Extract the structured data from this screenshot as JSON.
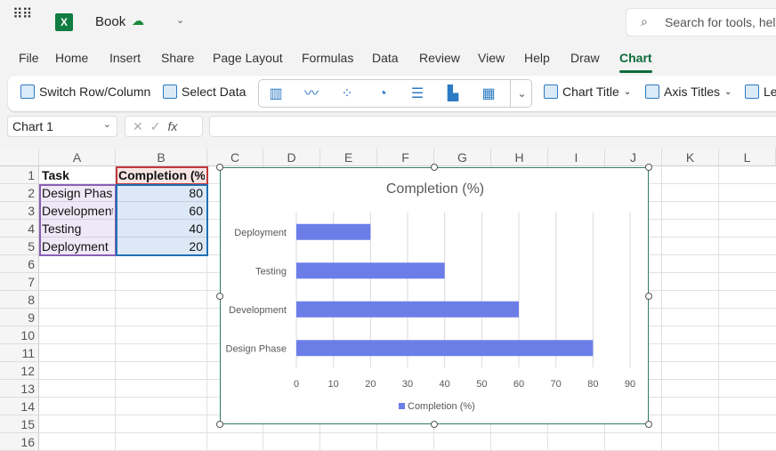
{
  "titlebar": {
    "app_icon": "excel-logo",
    "doc_name": "Book",
    "search_placeholder": "Search for tools, help"
  },
  "menu_tabs": [
    "File",
    "Home",
    "Insert",
    "Share",
    "Page Layout",
    "Formulas",
    "Data",
    "Review",
    "View",
    "Help",
    "Draw",
    "Chart"
  ],
  "active_tab": "Chart",
  "ribbon": {
    "switch": "Switch Row/Column",
    "select": "Select Data",
    "chart_title": "Chart Title",
    "axis_titles": "Axis Titles",
    "legend": "Le"
  },
  "formula_bar": {
    "name_box": "Chart 1",
    "fx": "fx",
    "formula": ""
  },
  "columns": [
    "A",
    "B",
    "C",
    "D",
    "E",
    "F",
    "G",
    "H",
    "I",
    "J",
    "K",
    "L"
  ],
  "rows": [
    "1",
    "2",
    "3",
    "4",
    "5",
    "6",
    "7",
    "8",
    "9",
    "10",
    "11",
    "12",
    "13",
    "14",
    "15",
    "16"
  ],
  "cells": {
    "A1": "Task",
    "B1": "Completion (%)",
    "A2": "Design Phase",
    "B2": "80",
    "A3": "Development",
    "B3": "60",
    "A4": "Testing",
    "B4": "40",
    "A5": "Deployment",
    "B5": "20"
  },
  "colors": {
    "bar": "#6b7ee8",
    "accent": "#0e6b3a"
  },
  "chart_data": {
    "type": "bar",
    "orientation": "horizontal",
    "title": "Completion (%)",
    "categories": [
      "Design Phase",
      "Development",
      "Testing",
      "Deployment"
    ],
    "values": [
      80,
      60,
      40,
      20
    ],
    "xlim": [
      0,
      90
    ],
    "ticks": [
      "0",
      "10",
      "20",
      "30",
      "40",
      "50",
      "60",
      "70",
      "80",
      "90"
    ],
    "legend": "Completion (%)",
    "legend_position": "bottom",
    "grid": true
  }
}
